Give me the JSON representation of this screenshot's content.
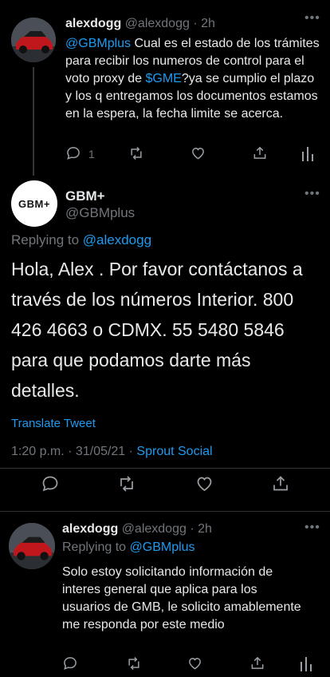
{
  "tweet1": {
    "name": "alexdogg",
    "handle": "@alexdogg",
    "time": "2h",
    "mention": "@GBMplus",
    "text_a": " Cual es el estado de los trámites para recibir los numeros de control para el voto proxy de ",
    "cashtag": "$GME",
    "text_b": "?ya se cumplio el plazo y los q entregamos los documentos estamos en la espera, la fecha limite se acerca.",
    "reply_count": "1"
  },
  "tweet2": {
    "avatar_text": "GBM+",
    "name": "GBM+",
    "handle": "@GBMplus",
    "replying_prefix": "Replying to ",
    "replying_to": "@alexdogg",
    "text": "Hola, Alex . Por favor contáctanos a través de los números Interior. 800 426 4663 o CDMX. 55 5480 5846 para que podamos darte más detalles.",
    "translate": "Translate Tweet",
    "timestamp": "1:20 p.m. · 31/05/21 · ",
    "source": "Sprout Social"
  },
  "tweet3": {
    "name": "alexdogg",
    "handle": "@alexdogg",
    "time": "2h",
    "replying_prefix": "Replying to ",
    "replying_to": "@GBMplus",
    "text": "Solo estoy solicitando información de interes general que aplica para los usuarios de GMB, le solicito amablemente me responda por este medio"
  },
  "colors": {
    "link": "#1d9bf0",
    "muted": "#71767b",
    "background": "#000000"
  }
}
